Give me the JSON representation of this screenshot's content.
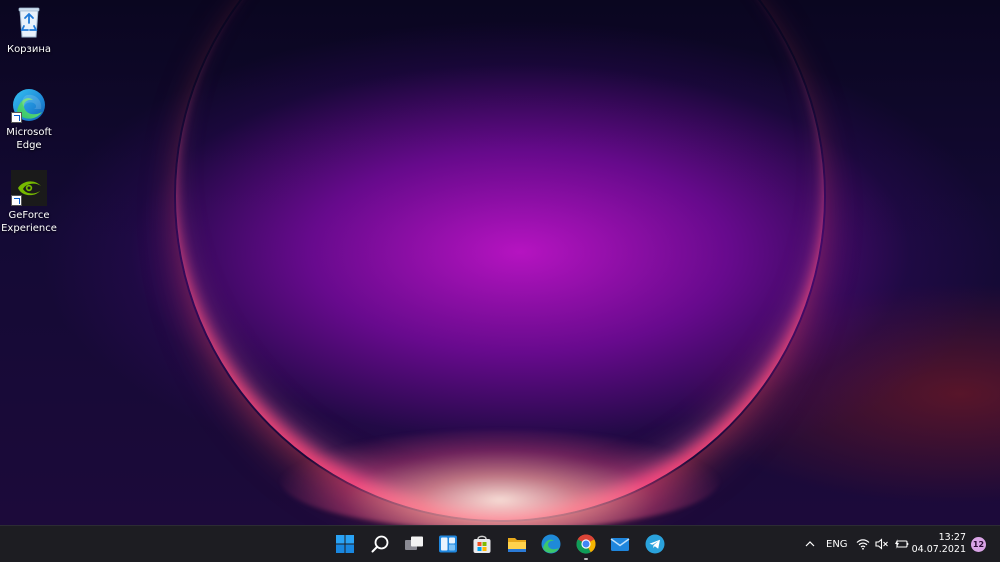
{
  "desktop": {
    "icons": [
      {
        "label": "Корзина",
        "icon": "recycle-bin-icon"
      },
      {
        "label_line1": "Microsoft",
        "label_line2": "Edge",
        "icon": "edge-icon"
      },
      {
        "label_line1": "GeForce",
        "label_line2": "Experience",
        "icon": "geforce-icon"
      }
    ]
  },
  "taskbar": {
    "apps": [
      {
        "name": "Start",
        "icon": "windows-start-icon"
      },
      {
        "name": "Search",
        "icon": "search-icon"
      },
      {
        "name": "Task View",
        "icon": "task-view-icon"
      },
      {
        "name": "Widgets",
        "icon": "widgets-icon"
      },
      {
        "name": "Microsoft Store",
        "icon": "store-icon"
      },
      {
        "name": "File Explorer",
        "icon": "file-explorer-icon"
      },
      {
        "name": "Microsoft Edge",
        "icon": "edge-icon"
      },
      {
        "name": "Google Chrome",
        "icon": "chrome-icon",
        "running": true
      },
      {
        "name": "Mail",
        "icon": "mail-icon"
      },
      {
        "name": "Telegram",
        "icon": "telegram-icon"
      }
    ],
    "tray": {
      "language": "ENG",
      "time": "13:27",
      "date": "04.07.2021",
      "notifications": "12"
    }
  },
  "colors": {
    "taskbar_bg": "#1d1d22",
    "accent_blue": "#0078d4",
    "badge": "#d9a4e6"
  }
}
